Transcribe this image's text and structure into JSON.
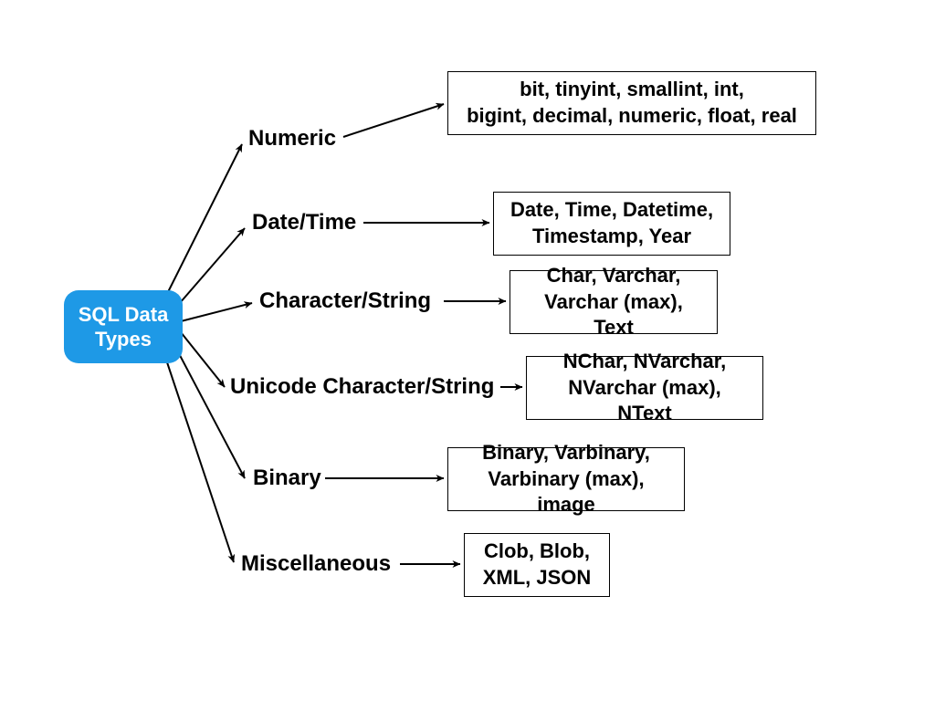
{
  "root": {
    "label": "SQL Data\nTypes",
    "color": "#1e99e6"
  },
  "categories": [
    {
      "label": "Numeric",
      "details": "bit, tinyint, smallint, int,\nbigint, decimal, numeric, float, real"
    },
    {
      "label": "Date/Time",
      "details": "Date, Time, Datetime,\nTimestamp, Year"
    },
    {
      "label": "Character/String",
      "details": "Char, Varchar,\nVarchar (max), Text"
    },
    {
      "label": "Unicode Character/String",
      "details": "NChar, NVarchar,\nNVarchar (max), NText"
    },
    {
      "label": "Binary",
      "details": "Binary, Varbinary,\nVarbinary (max), image"
    },
    {
      "label": "Miscellaneous",
      "details": "Clob, Blob,\nXML, JSON"
    }
  ]
}
